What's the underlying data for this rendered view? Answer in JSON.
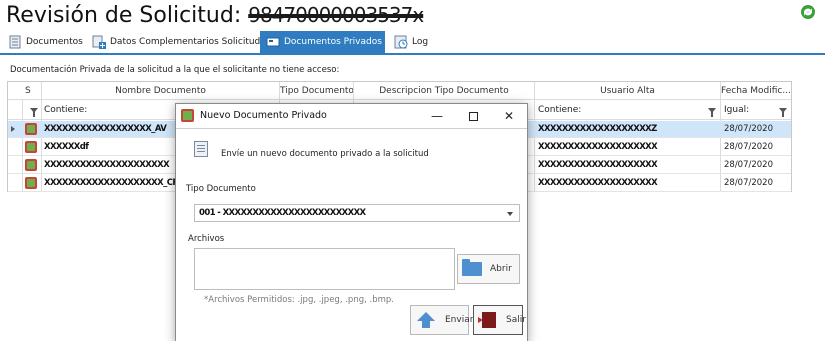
{
  "page": {
    "title_prefix": "Revisión de Solicitud:",
    "title_code": "98470000003537x"
  },
  "tabs": [
    {
      "label": "Documentos",
      "icon": "document-list-icon",
      "active": false
    },
    {
      "label": "Datos Complementarios Solicitud",
      "icon": "document-add-icon",
      "active": false
    },
    {
      "label": "Documentos Privados",
      "icon": "private-document-icon",
      "active": true
    },
    {
      "label": "Log",
      "icon": "log-icon",
      "active": false
    }
  ],
  "description": "Documentación Privada de la solicitud a la que el solicitante no tiene acceso:",
  "grid": {
    "columns": [
      "S",
      "Nombre Documento",
      "Tipo Documento",
      "Descripcion Tipo Documento",
      "Usuario Alta",
      "Fecha Modific..."
    ],
    "filters": {
      "nombre": "Contiene:",
      "usuario": "Contiene:",
      "fecha": "Igual:"
    },
    "rows": [
      {
        "nombre": "XXXXXXXXXXXXXXXXXX_AV",
        "usuario": "XXXXXXXXXXXXXXXXXXXZ",
        "fecha": "28/07/2020",
        "selected": true
      },
      {
        "nombre": "XXXXXXdf",
        "usuario": "XXXXXXXXXXXXXXXXXXXX",
        "fecha": "28/07/2020",
        "selected": false
      },
      {
        "nombre": "XXXXXXXXXXXXXXXXXXXXX",
        "usuario": "XXXXXXXXXXXXXXXXXXXX",
        "fecha": "28/07/2020",
        "selected": false
      },
      {
        "nombre": "XXXXXXXXXXXXXXXXXXXX_CR",
        "usuario": "XXXXXXXXXXXXXXXXXXXX",
        "fecha": "28/07/2020",
        "selected": false
      }
    ]
  },
  "dialog": {
    "title": "Nuevo Documento Privado",
    "message": "Envíe un nuevo documento privado a la solicitud",
    "tipo_label": "Tipo Documento",
    "tipo_value": "001 - XXXXXXXXXXXXXXXXXXXXXXXX",
    "archivos_label": "Archivos",
    "abrir_label": "Abrir",
    "hint": "*Archivos Permitidos: .jpg, .jpeg, .png, .bmp.",
    "enviar_label": "Enviar",
    "salir_label": "Salir"
  },
  "colors": {
    "accent": "#2f7cc1",
    "selected_row": "#cfe5f9"
  }
}
